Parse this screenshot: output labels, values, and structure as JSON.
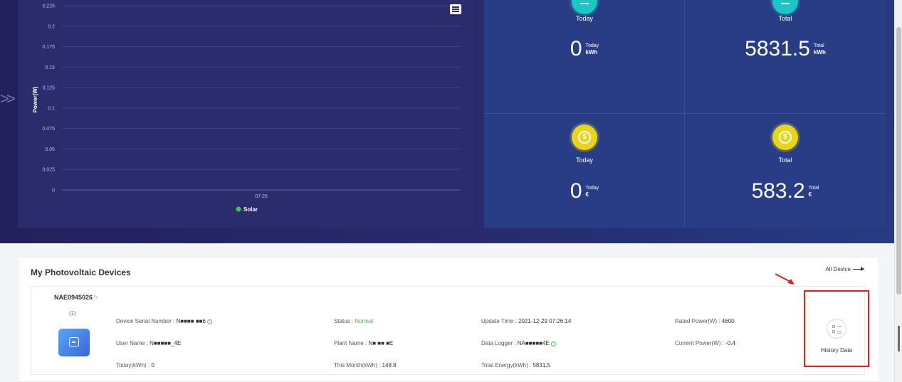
{
  "chart": {
    "y_label": "Power(W)",
    "y_ticks": [
      "0.225",
      "0.2",
      "0.175",
      "0.15",
      "0.125",
      "0.1",
      "0.075",
      "0.05",
      "0.025",
      "0"
    ],
    "x_tick": "07:25",
    "legend_label": "Solar",
    "legend_color": "#3ec44a",
    "menu_icon": "hamburger-menu-icon"
  },
  "chart_data": {
    "type": "line",
    "title": "",
    "xlabel": "",
    "ylabel": "Power(W)",
    "ylim": [
      0,
      0.225
    ],
    "x": [
      "07:25"
    ],
    "series": [
      {
        "name": "Solar",
        "values": []
      }
    ],
    "grid": true,
    "legend": "bottom-center"
  },
  "stats": {
    "energy_today": {
      "caption": "Today",
      "value": "0",
      "unit_top": "Today",
      "unit_bottom": "kWh",
      "icon": "solar-panel-icon"
    },
    "energy_total": {
      "caption": "Total",
      "value": "5831.5",
      "unit_top": "Total",
      "unit_bottom": "kWh",
      "icon": "solar-panel-icon"
    },
    "income_today": {
      "caption": "Today",
      "value": "0",
      "unit_top": "Today",
      "unit_bottom": "€",
      "icon": "coin-icon"
    },
    "income_total": {
      "caption": "Total",
      "value": "583.2",
      "unit_top": "Total",
      "unit_bottom": "€",
      "icon": "coin-icon"
    }
  },
  "devices": {
    "title": "My Photovoltaic Devices",
    "all_device_label": "All Device",
    "device": {
      "id": "NAE0945026",
      "index": "(1)",
      "serial_label": "Device Serial Number : ",
      "serial_value": "N■■■■ ■■6",
      "status_label": "Status : ",
      "status_value": "Normal",
      "update_label": "Update Time : ",
      "update_value": "2021-12-29 07:26:14",
      "rated_label": "Rated Power(W) : ",
      "rated_value": "4600",
      "user_label": "User Name : ",
      "user_value": "N■■■■■_4E",
      "plant_label": "Plant Name : ",
      "plant_value": "N■ ■■ ■E",
      "logger_label": "Data Logger : ",
      "logger_value": "NA■■■■■4E",
      "current_label": "Current Power(W) : ",
      "current_value": "-0.4",
      "today_label": "Today(kWh) : ",
      "today_value": "0",
      "month_label": "This Month(kWh) : ",
      "month_value": "148.8",
      "total_label": "Total Energy(kWh) : ",
      "total_value": "5831.5",
      "history_label": "History Data",
      "accent_status": "#55b54a",
      "highlight_color": "#e02020"
    }
  }
}
